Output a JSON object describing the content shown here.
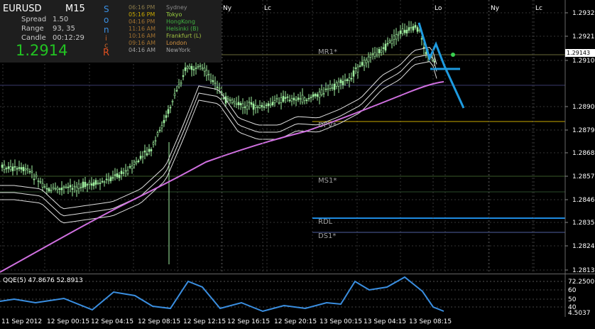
{
  "chart": {
    "symbol": "EURUSD",
    "timeframe": "M15",
    "last_price_tag": "1.29143",
    "price_axis": [
      "1.29320",
      "1.29210",
      "1.29100",
      "1.28900",
      "1.28790",
      "1.28680",
      "1.28570",
      "1.28460",
      "1.28350",
      "1.28240",
      "1.28130"
    ],
    "session_markers": [
      "Ny",
      "Lc",
      "Lo",
      "Ny",
      "Lc"
    ],
    "pivot_labels": [
      "MR1*",
      "DPV*",
      "MS1*",
      "RDL",
      "DS1*"
    ],
    "time_axis": [
      "11 Sep 2012",
      "12 Sep 00:15",
      "12 Sep 04:15",
      "12 Sep 08:15",
      "12 Sep 12:15",
      "12 Sep 16:15",
      "12 Sep 20:15",
      "13 Sep 00:15",
      "13 Sep 04:15",
      "13 Sep 08:15"
    ],
    "colors": {
      "candles": "#a0f0a0",
      "bands": "#ffffff",
      "ma": "#d070e0",
      "trend": "#1e9be0"
    }
  },
  "info": {
    "spread_label": "Spread",
    "spread_value": "1.50",
    "range_label": "Range",
    "range_value": "93, 35",
    "candle_label": "Candle",
    "candle_value": "00:12:29",
    "price": "1.2914",
    "sonic_letters": [
      "S",
      "o",
      "n",
      "i",
      "c",
      "R"
    ]
  },
  "sessions": [
    {
      "time": "06:16 PM",
      "name": "Sydney"
    },
    {
      "time": "05:16 PM",
      "name": "Tokyo"
    },
    {
      "time": "04:16 PM",
      "name": "HongKong"
    },
    {
      "time": "11:16 AM",
      "name": "Helsinki  (B)"
    },
    {
      "time": "10:16 AM",
      "name": "Frankfurt  (L)"
    },
    {
      "time": "09:16 AM",
      "name": "London"
    },
    {
      "time": "04:16 AM",
      "name": "NewYork"
    }
  ],
  "qqe": {
    "title": "QQE(5) 47.8676 52.8913",
    "axis": [
      "72.2500",
      "60",
      "50",
      "40",
      "4.5037"
    ]
  }
}
